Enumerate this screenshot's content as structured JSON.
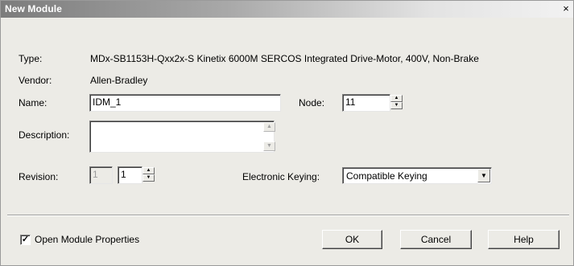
{
  "window": {
    "title": "New Module",
    "close_glyph": "×"
  },
  "type": {
    "label": "Type:",
    "value": "MDx-SB1153H-Qxx2x-S Kinetix 6000M SERCOS Integrated Drive-Motor, 400V, Non-Brake"
  },
  "vendor": {
    "label": "Vendor:",
    "value": "Allen-Bradley"
  },
  "name": {
    "label": "Name:",
    "value": "IDM_1"
  },
  "node": {
    "label": "Node:",
    "value": "11"
  },
  "description": {
    "label": "Description:",
    "value": ""
  },
  "revision": {
    "label": "Revision:",
    "major": "1",
    "minor": "1"
  },
  "keying": {
    "label": "Electronic Keying:",
    "value": "Compatible Keying"
  },
  "open_props": {
    "label": "Open Module Properties",
    "checked": true,
    "check_glyph": "✓"
  },
  "buttons": {
    "ok": "OK",
    "cancel": "Cancel",
    "help": "Help"
  }
}
